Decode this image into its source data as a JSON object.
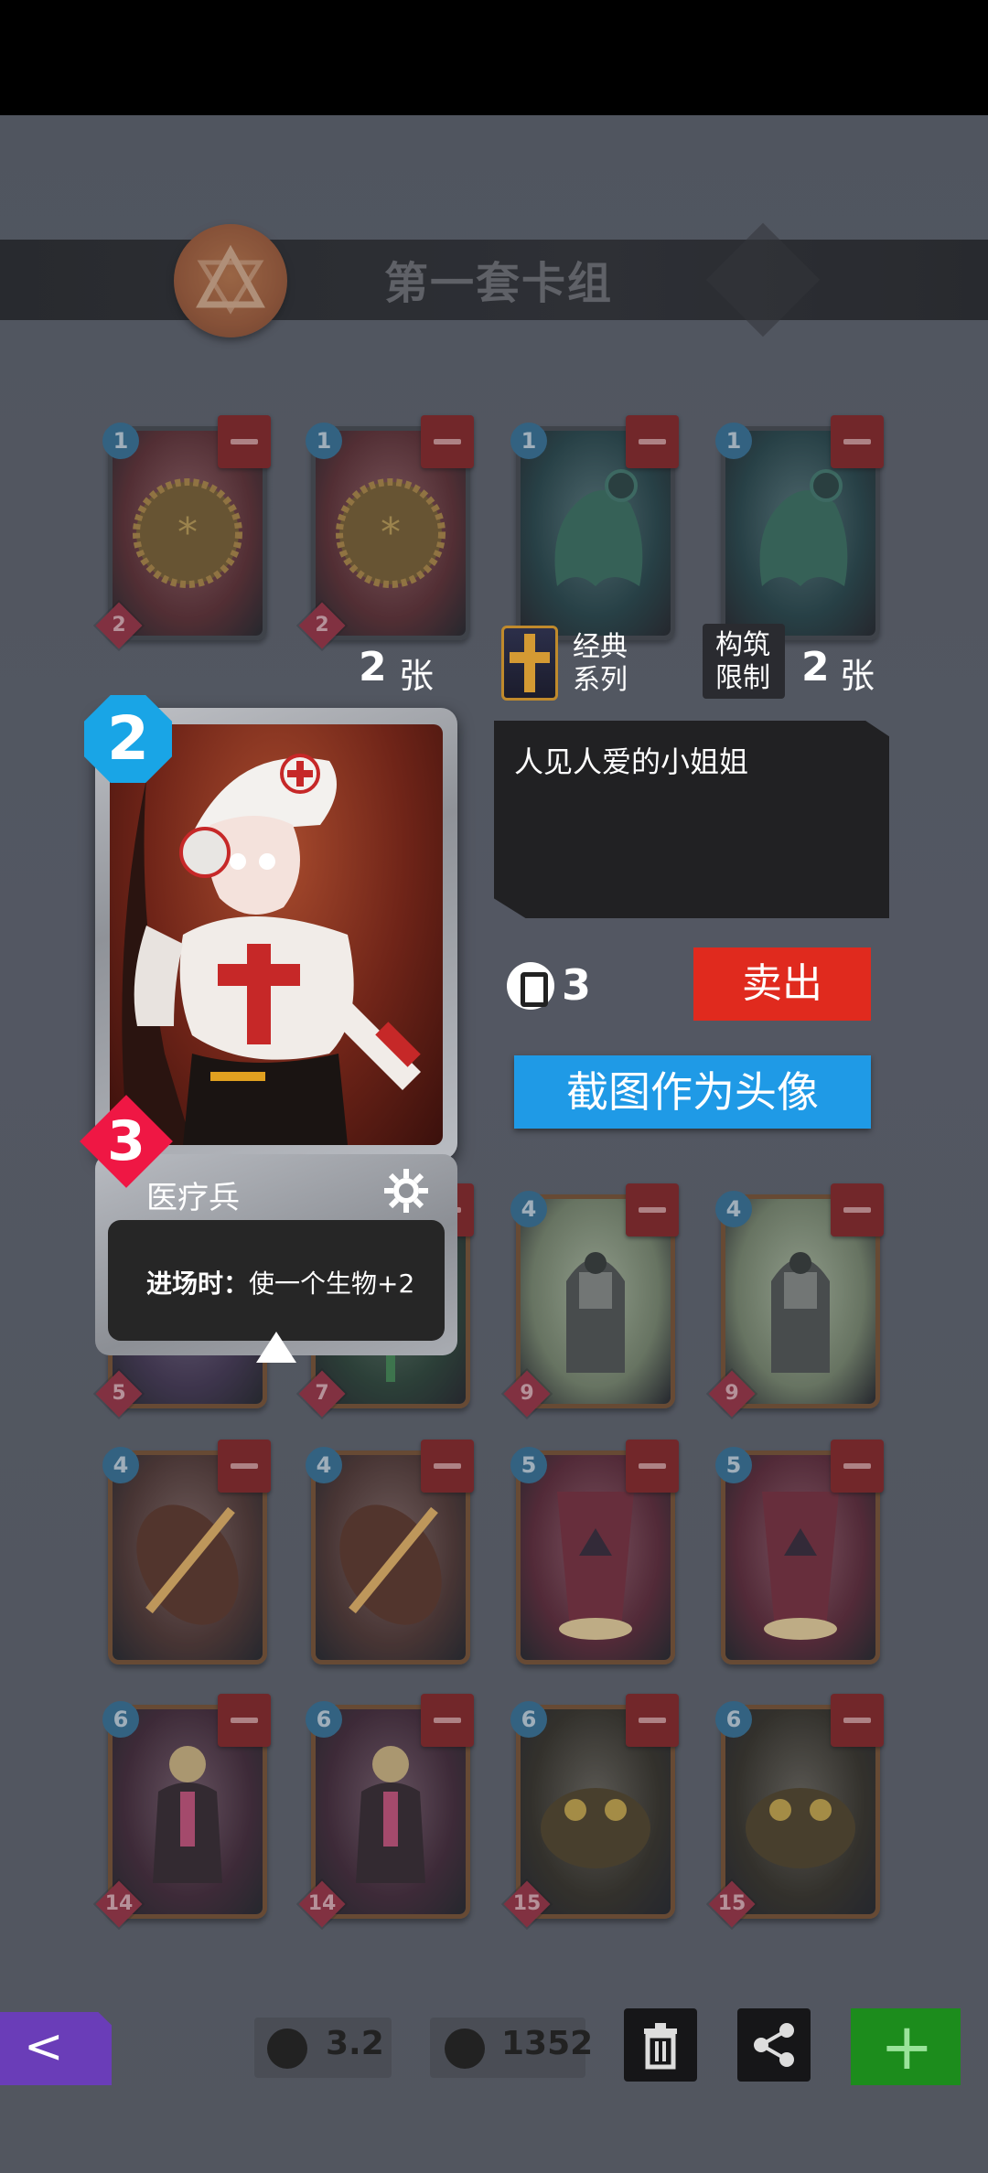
{
  "header": {
    "deck_title": "第一套卡组"
  },
  "deck_info": {
    "left_count": "2",
    "left_unit": "张",
    "series_label": "经典系列",
    "series_line1": "经典",
    "series_line2": "系列",
    "limit_line1": "构筑",
    "limit_line2": "限制",
    "right_count": "2",
    "right_unit": "张"
  },
  "grid_cards": [
    {
      "cost": "1",
      "power": "2",
      "art": "bottlecap",
      "color": "#5a2024"
    },
    {
      "cost": "1",
      "power": "2",
      "art": "bottlecap",
      "color": "#5a2024"
    },
    {
      "cost": "1",
      "power": "",
      "art": "ghost",
      "color": "#173a3e"
    },
    {
      "cost": "1",
      "power": "",
      "art": "ghost",
      "color": "#173a3e"
    },
    {
      "cost": "",
      "power": "5",
      "art": "mech",
      "color": "#3b2a4a"
    },
    {
      "cost": "",
      "power": "7",
      "art": "plant",
      "color": "#1f3a2a"
    },
    {
      "cost": "4",
      "power": "9",
      "art": "knight",
      "color": "#7a8a6a"
    },
    {
      "cost": "4",
      "power": "9",
      "art": "knight",
      "color": "#7a8a6a"
    },
    {
      "cost": "4",
      "power": "",
      "art": "slash",
      "color": "#4a2a24"
    },
    {
      "cost": "4",
      "power": "",
      "art": "slash",
      "color": "#4a2a24"
    },
    {
      "cost": "5",
      "power": "",
      "art": "portal",
      "color": "#5a1a2a"
    },
    {
      "cost": "5",
      "power": "",
      "art": "portal",
      "color": "#5a1a2a"
    },
    {
      "cost": "6",
      "power": "14",
      "art": "boss",
      "color": "#3a1a2a"
    },
    {
      "cost": "6",
      "power": "14",
      "art": "boss",
      "color": "#3a1a2a"
    },
    {
      "cost": "6",
      "power": "15",
      "art": "toad",
      "color": "#2a2418"
    },
    {
      "cost": "6",
      "power": "15",
      "art": "toad",
      "color": "#2a2418"
    }
  ],
  "selected_card": {
    "cost": "2",
    "power": "3",
    "name": "医疗兵",
    "desc_keyword": "进场时：",
    "desc_effect": "使一个生物+2",
    "flavor": "人见人爱的小姐姐",
    "price": "3",
    "icons": {
      "settings": "gear-icon"
    }
  },
  "actions": {
    "sell": "卖出",
    "set_avatar": "截图作为头像"
  },
  "bottom_bar": {
    "back_icon": "chevron-left-icon",
    "avg_cost": "3.2",
    "currency": "1352",
    "delete_icon": "trash-icon",
    "share_icon": "share-icon",
    "add_icon": "plus-icon"
  },
  "colors": {
    "sell": "#e02a1e",
    "avatar": "#1f9ae6",
    "back": "#6a3db8",
    "add": "#1c8c1c",
    "cost_badge": "#19a5e6",
    "power_badge": "#ef1744"
  }
}
